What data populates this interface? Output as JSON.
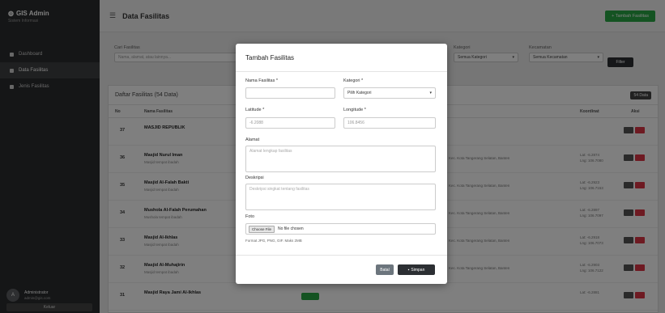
{
  "brand": {
    "title": "GIS Admin",
    "subtitle": "Sistem Informasi"
  },
  "sidebar": {
    "items": [
      {
        "label": "Dashboard",
        "active": false
      },
      {
        "label": "Data Fasilitas",
        "active": true
      },
      {
        "label": "Jenis Fasilitas",
        "active": false
      }
    ],
    "user": {
      "initial": "A",
      "name": "Administrator",
      "email": "admin@gis.com"
    },
    "logout_label": "Keluar"
  },
  "header": {
    "title": "Data Fasilitas",
    "add_label": "+ Tambah Fasilitas"
  },
  "filters": {
    "search_label": "Cari Fasilitas",
    "search_placeholder": "Nama, alamat, atau lainnya...",
    "category_label": "Kategori",
    "category_value": "Semua Kategori",
    "district_label": "Kecamatan",
    "district_value": "Semua Kecamatan",
    "filter_button": "Filter"
  },
  "table": {
    "title": "Daftar Fasilitas (54 Data)",
    "count_badge": "54 Data",
    "headers": {
      "no": "No",
      "name": "Nama Fasilitas",
      "coords": "Koordinat",
      "action": "Aksi"
    },
    "rows": [
      {
        "no": "37",
        "name": "MASJID REPUBLIK",
        "desc": "",
        "addr": "",
        "lat": "",
        "lng": "",
        "badge": false
      },
      {
        "no": "36",
        "name": "Masjid Nurul Iman",
        "desc": "Masjid tempat ibadah",
        "addr": "Kec. Kota Tangerang Selatan, Banten",
        "lat": "Lat: -6.2874",
        "lng": "Lng: 106.7080",
        "badge": false
      },
      {
        "no": "35",
        "name": "Masjid Al-Falah Bakti",
        "desc": "Masjid tempat ibadah",
        "addr": "Kec. Kota Tangerang Selatan, Banten",
        "lat": "Lat: -6.2923",
        "lng": "Lng: 106.7153",
        "badge": false
      },
      {
        "no": "34",
        "name": "Mushola Al-Falah Perumahan",
        "desc": "Mushola tempat ibadah",
        "addr": "Kec. Kota Tangerang Selatan, Banten",
        "lat": "Lat: -6.2897",
        "lng": "Lng: 106.7097",
        "badge": false
      },
      {
        "no": "33",
        "name": "Masjid Al-Ikhlas",
        "desc": "Masjid tempat ibadah",
        "addr": "Kec. Kota Tangerang Selatan, Banten",
        "lat": "Lat: -6.2918",
        "lng": "Lng: 106.7073",
        "badge": false
      },
      {
        "no": "32",
        "name": "Masjid Al-Muhajirin",
        "desc": "Masjid tempat ibadah",
        "addr": "Kec. Kota Tangerang Selatan, Banten",
        "lat": "Lat: -6.2903",
        "lng": "Lng: 106.7122",
        "badge": true
      },
      {
        "no": "31",
        "name": "Masjid Raya Jami Al-Ikhlas",
        "desc": "",
        "addr": "",
        "lat": "Lat: -6.2881",
        "lng": "",
        "badge": true
      }
    ]
  },
  "modal": {
    "title": "Tambah Fasilitas",
    "name_label": "Nama Fasilitas *",
    "category_label": "Kategori *",
    "category_value": "Pilih Kategori",
    "lat_label": "Latitude *",
    "lat_placeholder": "-6.2088",
    "lng_label": "Longitude *",
    "lng_placeholder": "106.8456",
    "address_label": "Alamat",
    "address_placeholder": "Alamat lengkap fasilitas",
    "desc_label": "Deskripsi",
    "desc_placeholder": "Deskripsi singkat tentang fasilitas",
    "photo_label": "Foto",
    "choose_file": "Choose File",
    "no_file": "No file chosen",
    "hint": "Format JPG, PNG, GIF. Maks 2MB",
    "cancel_label": "Batal",
    "save_label": "Simpan"
  }
}
